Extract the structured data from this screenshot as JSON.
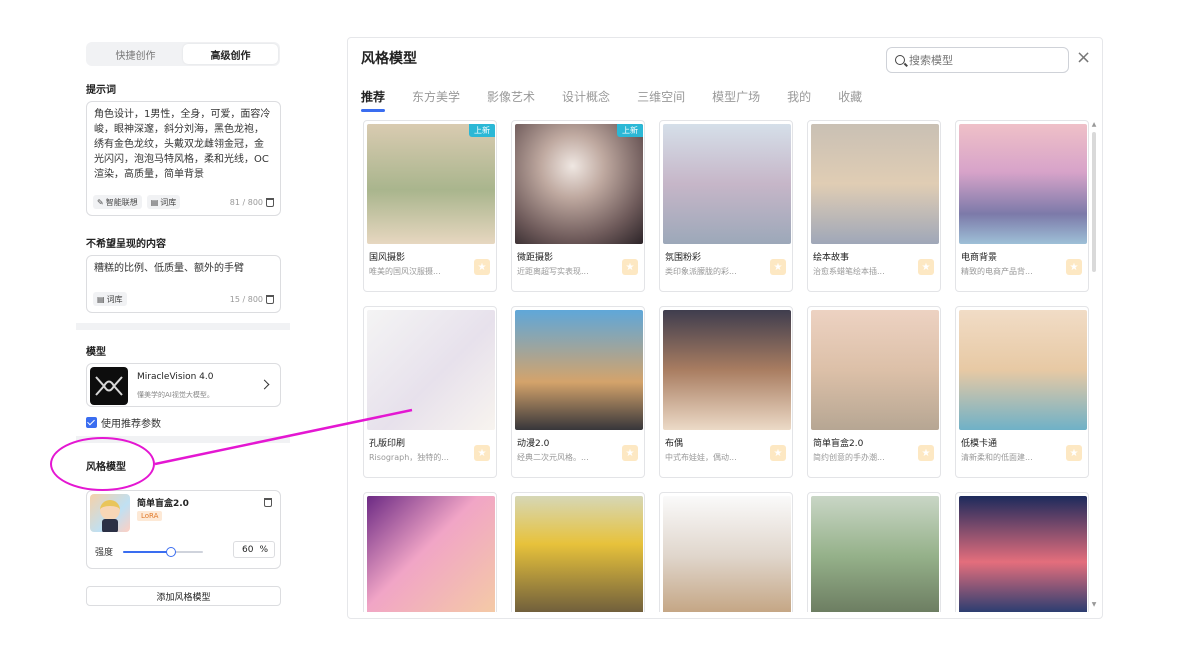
{
  "mode_tabs": [
    "快捷创作",
    "高级创作"
  ],
  "prompt": {
    "label": "提示词",
    "text": "角色设计，1男性，全身，可爱，面容冷峻，眼神深邃，斜分刘海，黑色龙袍，绣有金色龙纹，头戴双龙雌翎金冠，金光闪闪，泡泡马特风格，柔和光线，OC渲染，高质量，简单背景",
    "chip_assoc": "智能联想",
    "chip_lib": "词库",
    "counter": "81 / 800"
  },
  "negative": {
    "label": "不希望呈现的内容",
    "text": "糟糕的比例、低质量、额外的手臂",
    "chip_lib": "词库",
    "counter": "15 / 800"
  },
  "model": {
    "label": "模型",
    "name": "MiracleVision 4.0",
    "desc": "懂美学的AI视觉大模型。",
    "recommend": "使用推荐参数"
  },
  "style_model": {
    "label": "风格模型",
    "name": "简单盲盒2.0",
    "tag": "LoRA",
    "strength_label": "强度",
    "strength_value": "60",
    "strength_unit": "%",
    "strength_fraction": 0.6,
    "add_label": "添加风格模型"
  },
  "modal": {
    "title": "风格模型",
    "search_placeholder": "搜索模型",
    "close": "×",
    "tabs": [
      "推荐",
      "东方美学",
      "影像艺术",
      "设计概念",
      "三维空间",
      "模型广场",
      "我的",
      "收藏"
    ],
    "new_badge": "上新",
    "cards": [
      {
        "name": "国风摄影",
        "desc": "唯美的国风汉服摄...",
        "new": true
      },
      {
        "name": "微距摄影",
        "desc": "近距离超写实表现...",
        "new": true
      },
      {
        "name": "氛围粉彩",
        "desc": "类印象派朦胧的彩...",
        "new": false
      },
      {
        "name": "绘本故事",
        "desc": "治愈系蜡笔绘本插...",
        "new": false
      },
      {
        "name": "电商背景",
        "desc": "精致的电商产品背...",
        "new": false
      },
      {
        "name": "孔版印刷",
        "desc": "Risograph，独特的...",
        "new": false
      },
      {
        "name": "动漫2.0",
        "desc": "经典二次元风格。...",
        "new": false
      },
      {
        "name": "布偶",
        "desc": "中式布娃娃，偶动...",
        "new": false
      },
      {
        "name": "简单盲盒2.0",
        "desc": "简约创意的手办潮...",
        "new": false
      },
      {
        "name": "低模卡通",
        "desc": "清新柔和的低面建...",
        "new": false
      },
      {
        "name": "",
        "desc": "",
        "new": false
      },
      {
        "name": "",
        "desc": "",
        "new": false
      },
      {
        "name": "",
        "desc": "",
        "new": false
      },
      {
        "name": "",
        "desc": "",
        "new": false
      },
      {
        "name": "",
        "desc": "",
        "new": false
      }
    ]
  },
  "colors": {
    "accent": "#3a6df0",
    "annotation": "#e417d2",
    "new_badge": "#2bb8d6"
  }
}
